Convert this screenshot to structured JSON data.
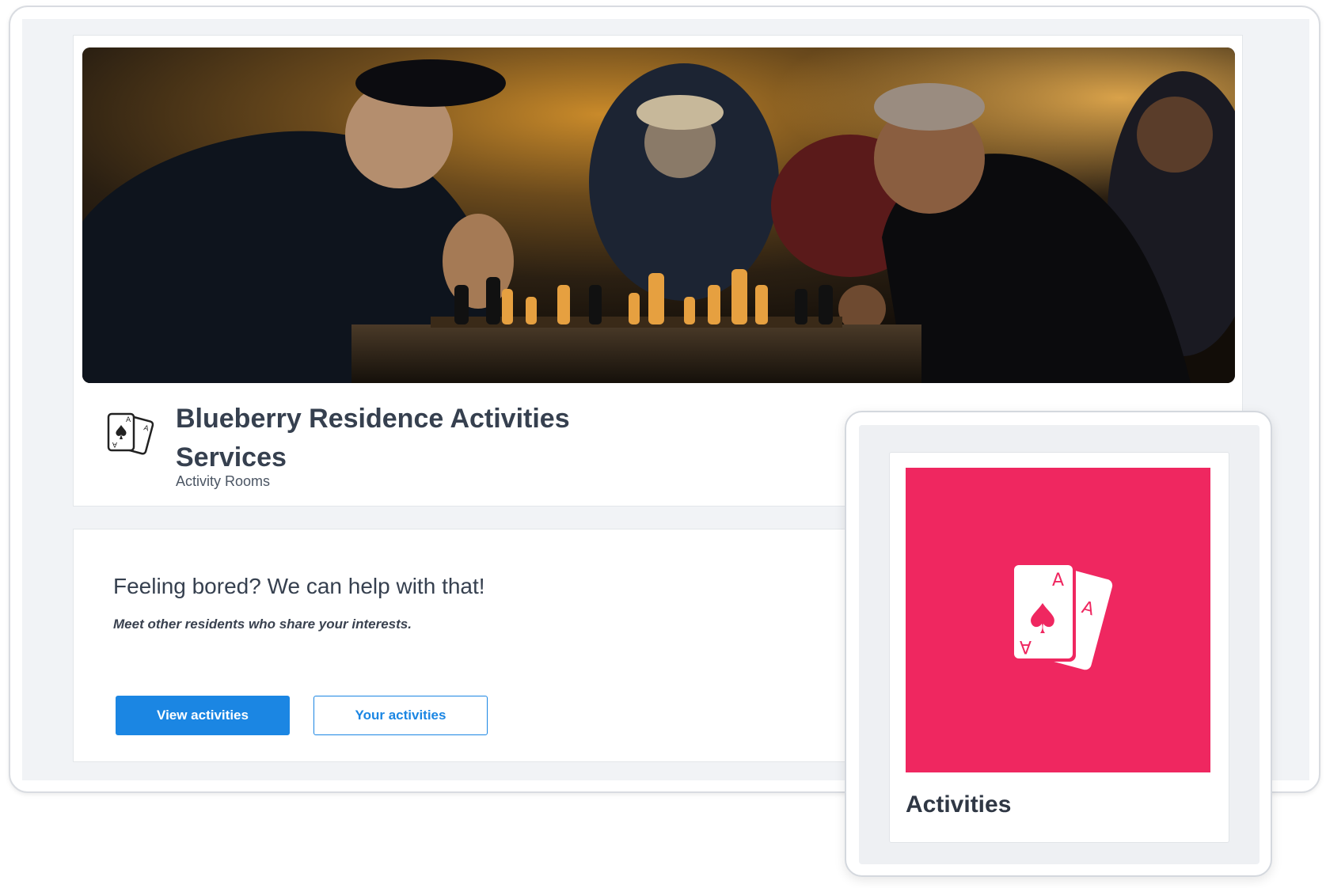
{
  "header": {
    "title": "Blueberry Residence Activities Services",
    "subtitle": "Activity Rooms",
    "icon": "playing-cards-icon"
  },
  "hero": {
    "image_subject": "elderly-men-playing-chess-photo"
  },
  "intro": {
    "heading": "Feeling bored? We can help with that!",
    "text": "Meet other residents who share your interests."
  },
  "buttons": {
    "view_activities": "View activities",
    "your_activities": "Your activities"
  },
  "tile": {
    "label": "Activities",
    "icon": "playing-cards-icon",
    "color": "#ef2760"
  },
  "colors": {
    "primary": "#1b86e3",
    "tile_accent": "#ef2760",
    "background": "#f1f3f6"
  }
}
